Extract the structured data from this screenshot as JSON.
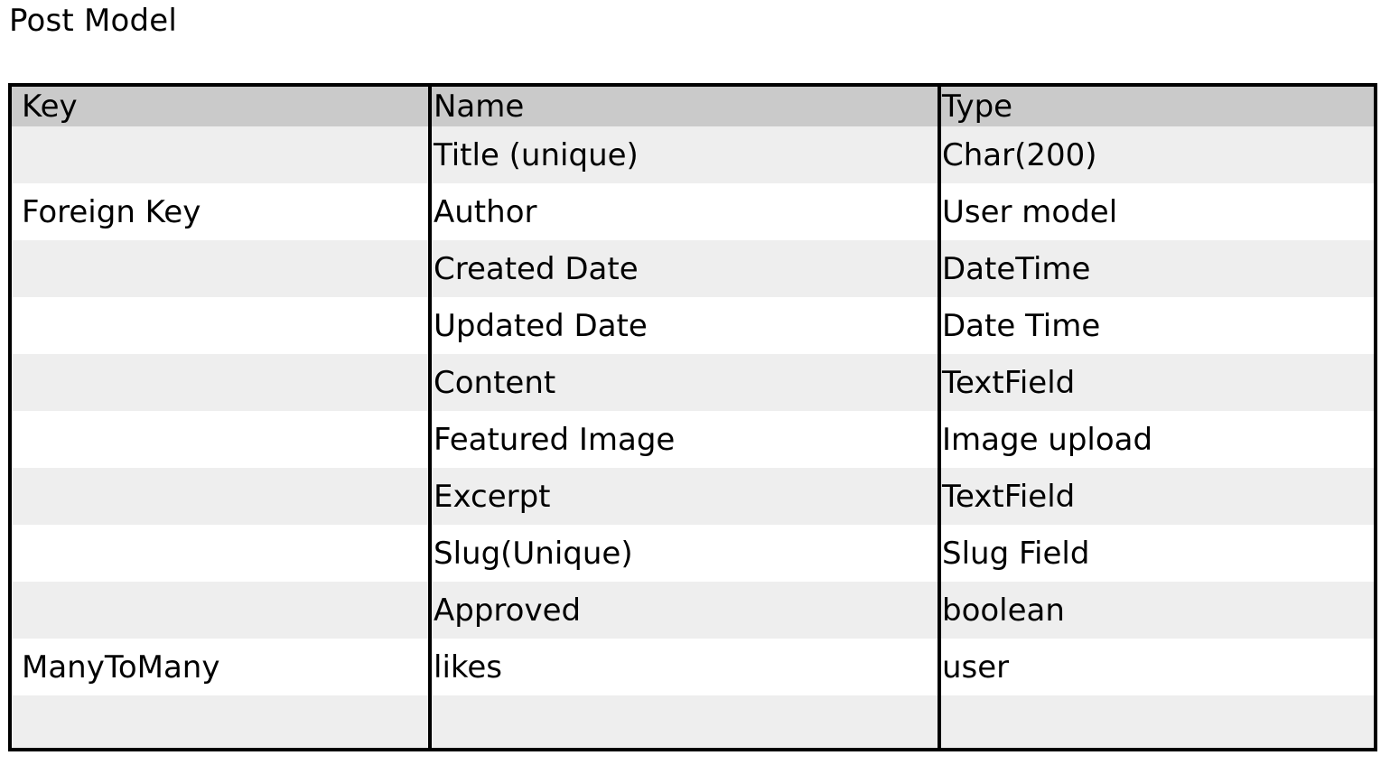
{
  "title": "Post Model",
  "table": {
    "headers": [
      "Key",
      "Name",
      "Type"
    ],
    "rows": [
      {
        "key": "",
        "name": "Title (unique)",
        "type": "Char(200)"
      },
      {
        "key": "Foreign Key",
        "name": "Author",
        "type": "User model"
      },
      {
        "key": "",
        "name": "Created Date",
        "type": "DateTime"
      },
      {
        "key": "",
        "name": "Updated Date",
        "type": "Date Time"
      },
      {
        "key": "",
        "name": "Content",
        "type": "TextField"
      },
      {
        "key": "",
        "name": "Featured Image",
        "type": "Image upload"
      },
      {
        "key": "",
        "name": "Excerpt",
        "type": "TextField"
      },
      {
        "key": "",
        "name": "Slug(Unique)",
        "type": "Slug Field"
      },
      {
        "key": "",
        "name": "Approved",
        "type": "boolean"
      },
      {
        "key": "ManyToMany",
        "name": "likes",
        "type": "user"
      },
      {
        "key": "",
        "name": "",
        "type": ""
      }
    ]
  }
}
